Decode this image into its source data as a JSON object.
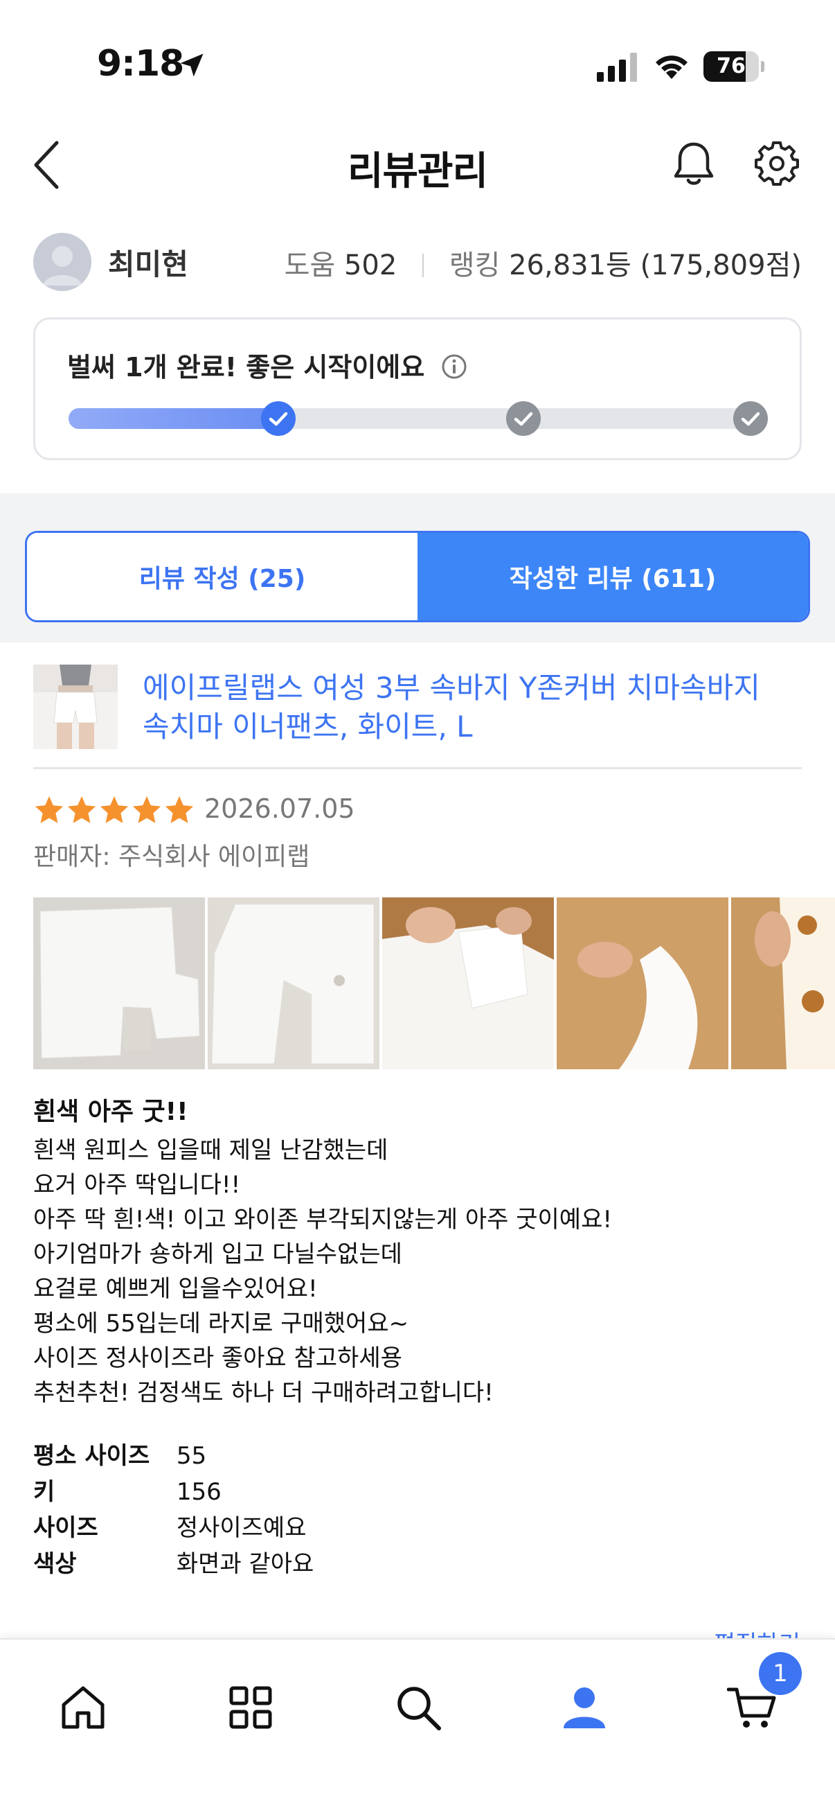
{
  "status_bar": {
    "time": "9:18",
    "battery_level": "76",
    "battery_fraction": 0.76,
    "icons": [
      "location-arrow-icon",
      "cellular-signal-icon",
      "wifi-icon",
      "battery-icon"
    ]
  },
  "header": {
    "title": "리뷰관리",
    "icons": [
      "back-chevron-icon",
      "bell-icon",
      "gear-icon"
    ]
  },
  "profile": {
    "name": "최미현",
    "help_label": "도움",
    "help_value": "502",
    "rank_label": "랭킹",
    "rank_value": "26,831등 (175,809점)"
  },
  "progress": {
    "message": "벌써 1개 완료! 좋은 시작이에요",
    "fraction": 0.3,
    "milestones_done": 1,
    "milestones_total": 3
  },
  "tabs": [
    {
      "label": "리뷰 작성 (25)",
      "active": false
    },
    {
      "label": "작성한 리뷰 (611)",
      "active": true
    }
  ],
  "review": {
    "product_title": "에이프릴랩스 여성 3부 속바지 Y존커버 치마속바지 속치마 이너팬츠, 화이트, L",
    "rating": 5,
    "date": "2026.07.05",
    "seller_label": "판매자:",
    "seller_name": "주식회사 에이피랩",
    "photo_count": 5,
    "headline": "흰색 아주 굿!!",
    "body_lines": [
      "흰색 원피스 입을때 제일 난감했는데",
      "요거 아주 딱입니다!!",
      "아주 딱 흰!색! 이고 와이존 부각되지않는게 아주 굿이예요!",
      "아기엄마가 숑하게 입고 다닐수없는데",
      "요걸로 예쁘게 입을수있어요!",
      "평소에 55입는데 라지로 구매했어요~",
      "사이즈 정사이즈라 좋아요 참고하세용",
      "추천추천! 검정색도 하나 더 구매하려고합니다!"
    ],
    "attributes": [
      {
        "label": "평소 사이즈",
        "value": "55"
      },
      {
        "label": "키",
        "value": "156"
      },
      {
        "label": "사이즈",
        "value": "정사이즈예요"
      },
      {
        "label": "색상",
        "value": "화면과 같아요"
      }
    ],
    "edit_label": "편집하기"
  },
  "bottom_nav": {
    "items": [
      "home-icon",
      "grid-icon",
      "search-icon",
      "profile-icon",
      "cart-icon"
    ],
    "cart_badge": "1",
    "active_color": "#3d74f2"
  },
  "colors": {
    "accent": "#3d74f2",
    "tab_active": "#3d86f8",
    "star": "#f5922e",
    "gray_band": "#f2f3f5"
  }
}
